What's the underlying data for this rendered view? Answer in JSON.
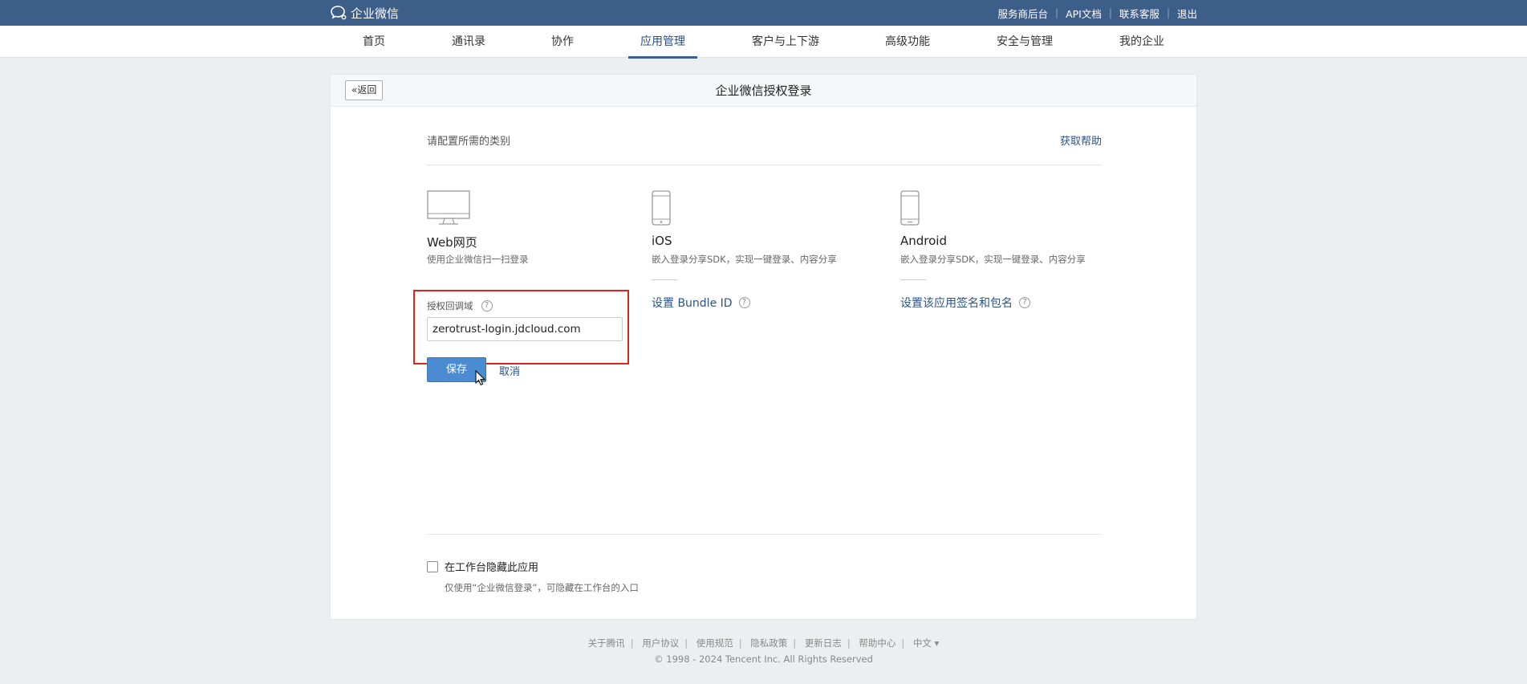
{
  "brand": {
    "name": "企业微信"
  },
  "top_links": [
    "服务商后台",
    "API文档",
    "联系客服",
    "退出"
  ],
  "nav": {
    "items": [
      "首页",
      "通讯录",
      "协作",
      "应用管理",
      "客户与上下游",
      "高级功能",
      "安全与管理",
      "我的企业"
    ],
    "active_index": 3
  },
  "card": {
    "back_label": "返回",
    "title": "企业微信授权登录",
    "section_label": "请配置所需的类别",
    "help_link": "获取帮助"
  },
  "platforms": [
    {
      "name": "Web网页",
      "desc": "使用企业微信扫一扫登录",
      "icon": "monitor-icon"
    },
    {
      "name": "iOS",
      "desc": "嵌入登录分享SDK，实现一键登录、内容分享",
      "link": "设置 Bundle ID",
      "icon": "phone-icon"
    },
    {
      "name": "Android",
      "desc": "嵌入登录分享SDK，实现一键登录、内容分享",
      "link": "设置该应用签名和包名",
      "icon": "phone-icon"
    }
  ],
  "web_config": {
    "field_label": "授权回调域",
    "domain_value": "zerotrust-login.jdcloud.com",
    "save_label": "保存",
    "cancel_label": "取消"
  },
  "help_mark": "?",
  "hide_option": {
    "label": "在工作台隐藏此应用",
    "desc": "仅使用“企业微信登录”，可隐藏在工作台的入口",
    "checked": false
  },
  "footer": {
    "links": [
      "关于腾讯",
      "用户协议",
      "使用规范",
      "隐私政策",
      "更新日志",
      "帮助中心",
      "中文 ▾"
    ],
    "copyright": "© 1998 - 2024 Tencent Inc. All Rights Reserved"
  },
  "colors": {
    "topbar": "#3e5e8a",
    "link": "#2b5384",
    "primary_button": "#4a8bd1",
    "highlight": "#d9251d"
  }
}
